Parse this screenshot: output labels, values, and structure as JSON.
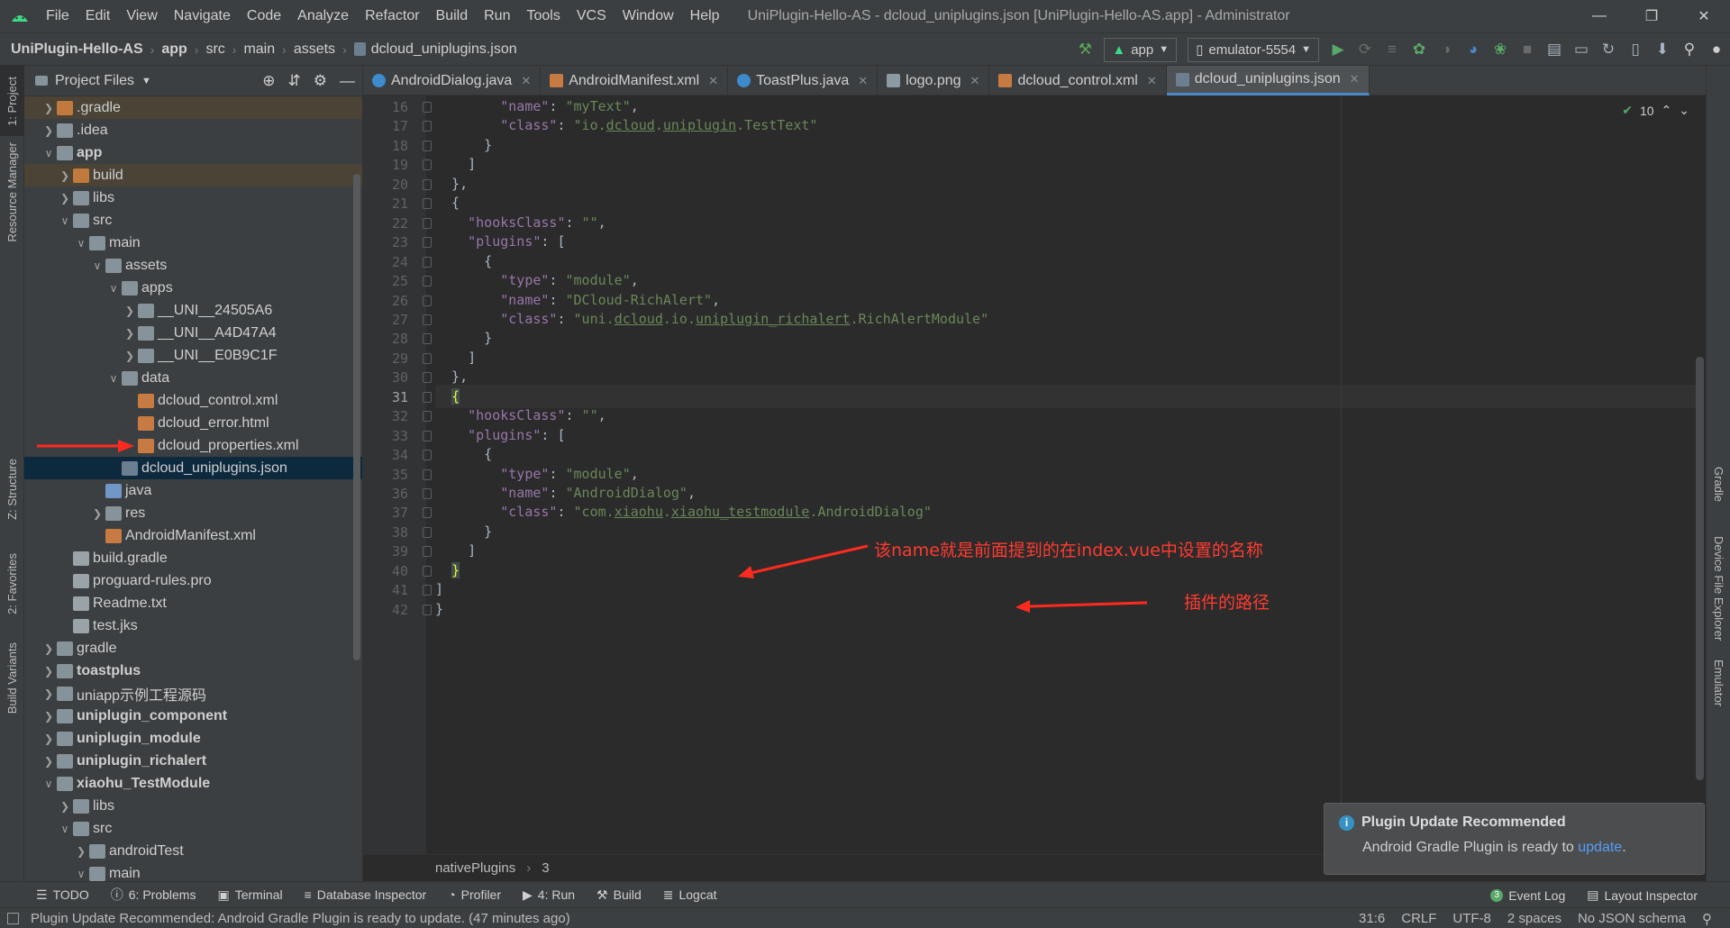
{
  "menubar": {
    "items": [
      "File",
      "Edit",
      "View",
      "Navigate",
      "Code",
      "Analyze",
      "Refactor",
      "Build",
      "Run",
      "Tools",
      "VCS",
      "Window",
      "Help"
    ],
    "window_title": "UniPlugin-Hello-AS - dcloud_uniplugins.json [UniPlugin-Hello-AS.app] - Administrator"
  },
  "navbar": {
    "crumbs": [
      "UniPlugin-Hello-AS",
      "app",
      "src",
      "main",
      "assets",
      "dcloud_uniplugins.json"
    ],
    "run_config": "app",
    "device": "emulator-5554"
  },
  "left_strip": {
    "project": "1: Project",
    "resource_manager": "Resource Manager",
    "structure": "Z: Structure",
    "favorites": "2: Favorites",
    "build_variants": "Build Variants"
  },
  "right_strip": {
    "gradle": "Gradle",
    "device_file_explorer": "Device File Explorer",
    "emulator": "Emulator"
  },
  "project_panel": {
    "title": "Project Files",
    "tree": [
      {
        "label": ".gradle",
        "depth": 0,
        "arrow": "right",
        "icon": "folder-orange",
        "hl": "brown"
      },
      {
        "label": ".idea",
        "depth": 0,
        "arrow": "right",
        "icon": "folder"
      },
      {
        "label": "app",
        "depth": 0,
        "arrow": "down",
        "icon": "folder",
        "bold": true
      },
      {
        "label": "build",
        "depth": 1,
        "arrow": "right",
        "icon": "folder-orange",
        "hl": "brown"
      },
      {
        "label": "libs",
        "depth": 1,
        "arrow": "right",
        "icon": "folder"
      },
      {
        "label": "src",
        "depth": 1,
        "arrow": "down",
        "icon": "folder"
      },
      {
        "label": "main",
        "depth": 2,
        "arrow": "down",
        "icon": "folder"
      },
      {
        "label": "assets",
        "depth": 3,
        "arrow": "down",
        "icon": "folder"
      },
      {
        "label": "apps",
        "depth": 4,
        "arrow": "down",
        "icon": "folder"
      },
      {
        "label": "__UNI__24505A6",
        "depth": 5,
        "arrow": "right",
        "icon": "folder"
      },
      {
        "label": "__UNI__A4D47A4",
        "depth": 5,
        "arrow": "right",
        "icon": "folder"
      },
      {
        "label": "__UNI__E0B9C1F",
        "depth": 5,
        "arrow": "right",
        "icon": "folder"
      },
      {
        "label": "data",
        "depth": 4,
        "arrow": "down",
        "icon": "folder"
      },
      {
        "label": "dcloud_control.xml",
        "depth": 5,
        "arrow": "none",
        "icon": "file"
      },
      {
        "label": "dcloud_error.html",
        "depth": 5,
        "arrow": "none",
        "icon": "file"
      },
      {
        "label": "dcloud_properties.xml",
        "depth": 5,
        "arrow": "none",
        "icon": "file"
      },
      {
        "label": "dcloud_uniplugins.json",
        "depth": 4,
        "arrow": "none",
        "icon": "json",
        "hl": "selected"
      },
      {
        "label": "java",
        "depth": 3,
        "arrow": "none",
        "icon": "folder-blue"
      },
      {
        "label": "res",
        "depth": 3,
        "arrow": "right",
        "icon": "folder"
      },
      {
        "label": "AndroidManifest.xml",
        "depth": 3,
        "arrow": "none",
        "icon": "file"
      },
      {
        "label": "build.gradle",
        "depth": 1,
        "arrow": "none",
        "icon": "grey"
      },
      {
        "label": "proguard-rules.pro",
        "depth": 1,
        "arrow": "none",
        "icon": "grey"
      },
      {
        "label": "Readme.txt",
        "depth": 1,
        "arrow": "none",
        "icon": "grey"
      },
      {
        "label": "test.jks",
        "depth": 1,
        "arrow": "none",
        "icon": "grey"
      },
      {
        "label": "gradle",
        "depth": 0,
        "arrow": "right",
        "icon": "folder"
      },
      {
        "label": "toastplus",
        "depth": 0,
        "arrow": "right",
        "icon": "folder",
        "bold": true
      },
      {
        "label": "uniapp示例工程源码",
        "depth": 0,
        "arrow": "right",
        "icon": "folder"
      },
      {
        "label": "uniplugin_component",
        "depth": 0,
        "arrow": "right",
        "icon": "folder",
        "bold": true
      },
      {
        "label": "uniplugin_module",
        "depth": 0,
        "arrow": "right",
        "icon": "folder",
        "bold": true
      },
      {
        "label": "uniplugin_richalert",
        "depth": 0,
        "arrow": "right",
        "icon": "folder",
        "bold": true
      },
      {
        "label": "xiaohu_TestModule",
        "depth": 0,
        "arrow": "down",
        "icon": "folder",
        "bold": true
      },
      {
        "label": "libs",
        "depth": 1,
        "arrow": "right",
        "icon": "folder"
      },
      {
        "label": "src",
        "depth": 1,
        "arrow": "down",
        "icon": "folder"
      },
      {
        "label": "androidTest",
        "depth": 2,
        "arrow": "right",
        "icon": "folder"
      },
      {
        "label": "main",
        "depth": 2,
        "arrow": "down",
        "icon": "folder"
      }
    ]
  },
  "editor_tabs": [
    {
      "label": "AndroidDialog.java",
      "icon": "c"
    },
    {
      "label": "AndroidManifest.xml",
      "icon": "x"
    },
    {
      "label": "ToastPlus.java",
      "icon": "c"
    },
    {
      "label": "logo.png",
      "icon": "p"
    },
    {
      "label": "dcloud_control.xml",
      "icon": "x"
    },
    {
      "label": "dcloud_uniplugins.json",
      "icon": "j",
      "active": true
    }
  ],
  "editor": {
    "inspection_count": "10",
    "current_line": 31,
    "lines": [
      {
        "n": 16,
        "html": "        <span class='k'>\"name\"</span>: <span class='s'>\"myText\"</span>,"
      },
      {
        "n": 17,
        "html": "        <span class='k'>\"class\"</span>: <span class='s'>\"io.<span class='u'>dcloud</span>.<span class='u'>uniplugin</span>.TestText\"</span>"
      },
      {
        "n": 18,
        "html": "      }"
      },
      {
        "n": 19,
        "html": "    ]"
      },
      {
        "n": 20,
        "html": "  },"
      },
      {
        "n": 21,
        "html": "  {"
      },
      {
        "n": 22,
        "html": "    <span class='k'>\"hooksClass\"</span>: <span class='s'>\"\"</span>,"
      },
      {
        "n": 23,
        "html": "    <span class='k'>\"plugins\"</span>: ["
      },
      {
        "n": 24,
        "html": "      {"
      },
      {
        "n": 25,
        "html": "        <span class='k'>\"type\"</span>: <span class='s'>\"module\"</span>,"
      },
      {
        "n": 26,
        "html": "        <span class='k'>\"name\"</span>: <span class='s'>\"DCloud-RichAlert\"</span>,"
      },
      {
        "n": 27,
        "html": "        <span class='k'>\"class\"</span>: <span class='s'>\"uni.<span class='u'>dcloud</span>.io.<span class='u'>uniplugin_richalert</span>.RichAlertModule\"</span>"
      },
      {
        "n": 28,
        "html": "      }"
      },
      {
        "n": 29,
        "html": "    ]"
      },
      {
        "n": 30,
        "html": "  },"
      },
      {
        "n": 31,
        "html": "  <span class='br-hl'>{</span>"
      },
      {
        "n": 32,
        "html": "    <span class='k'>\"hooksClass\"</span>: <span class='s'>\"\"</span>,"
      },
      {
        "n": 33,
        "html": "    <span class='k'>\"plugins\"</span>: ["
      },
      {
        "n": 34,
        "html": "      {"
      },
      {
        "n": 35,
        "html": "        <span class='k'>\"type\"</span>: <span class='s'>\"module\"</span>,"
      },
      {
        "n": 36,
        "html": "        <span class='k'>\"name\"</span>: <span class='s'>\"AndroidDialog\"</span>,"
      },
      {
        "n": 37,
        "html": "        <span class='k'>\"class\"</span>: <span class='s'>\"com.<span class='u'>xiaohu</span>.<span class='u'>xiaohu_testmodule</span>.AndroidDialog\"</span>"
      },
      {
        "n": 38,
        "html": "      }"
      },
      {
        "n": 39,
        "html": "    ]"
      },
      {
        "n": 40,
        "html": "  <span class='br-hl'>}</span>"
      },
      {
        "n": 41,
        "html": "]"
      },
      {
        "n": 42,
        "html": "}"
      }
    ],
    "breadcrumb": [
      "nativePlugins",
      "3"
    ]
  },
  "annotations": {
    "name_note": "该name就是前面提到的在index.vue中设置的名称",
    "class_note": "插件的路径"
  },
  "notification": {
    "title": "Plugin Update Recommended",
    "body": "Android Gradle Plugin is ready to ",
    "link": "update",
    "suffix": "."
  },
  "bottom_tools": {
    "left": [
      "TODO",
      "6: Problems",
      "Terminal",
      "Database Inspector",
      "Profiler",
      "4: Run",
      "Build",
      "Logcat"
    ],
    "right": [
      "Event Log",
      "Layout Inspector"
    ]
  },
  "statusbar": {
    "message": "Plugin Update Recommended: Android Gradle Plugin is ready to update. (47 minutes ago)",
    "position": "31:6",
    "line_sep": "CRLF",
    "encoding": "UTF-8",
    "indent": "2 spaces",
    "schema": "No JSON schema"
  },
  "colors": {
    "accent": "#4a88c7",
    "annotation": "#ff3b30",
    "string": "#6a8759",
    "key": "#9876aa"
  }
}
